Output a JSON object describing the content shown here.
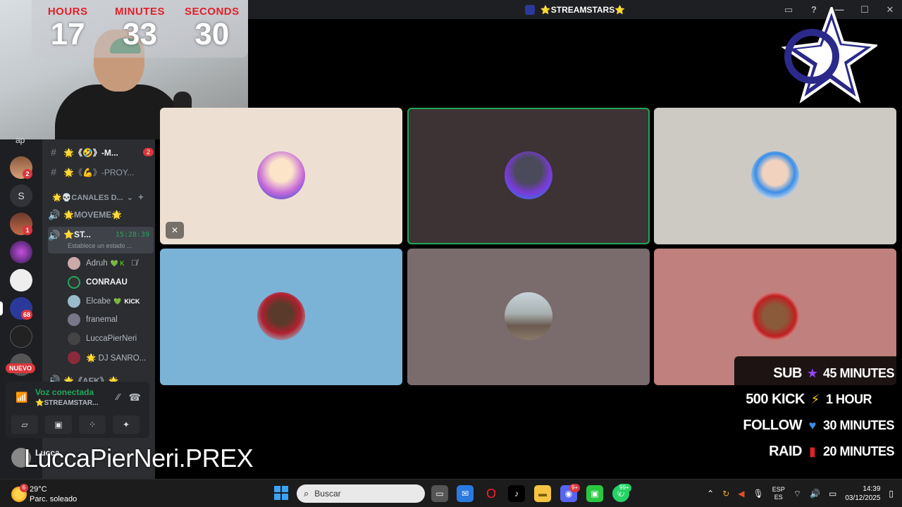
{
  "window": {
    "title": "⭐STREAMSTARS⭐"
  },
  "timer": {
    "hours_label": "HOURS",
    "hours": "17",
    "minutes_label": "MINUTES",
    "minutes": "33",
    "seconds_label": "SECONDS",
    "seconds": "30"
  },
  "rail": {
    "partial_top": "ap",
    "letter_server": "S",
    "badges": [
      "2",
      "1",
      "68"
    ],
    "nuevo": "NUEVO"
  },
  "channels": {
    "items": [
      {
        "label": "🌟《🤣》-M...",
        "badge": "2"
      },
      {
        "label": "🌟《💪》-PROY..."
      }
    ],
    "category": "🌟💀CANALES D...",
    "voice_moveme": "🌟MOVEME🌟",
    "active_voice": {
      "label": "⭐ST...",
      "time": "15:28:39",
      "status": "Establece un estado ..."
    },
    "members": [
      {
        "name": "Adruh",
        "extra": "💚 K"
      },
      {
        "name": "CONRAAU"
      },
      {
        "name": "Elcabe",
        "extra": "💚",
        "kick": "KICK"
      },
      {
        "name": "franemal"
      },
      {
        "name": "LuccaPierNeri"
      },
      {
        "name": "🌟 DJ SANRO..."
      }
    ],
    "afk": "🌟《AFK》🌟"
  },
  "voice_panel": {
    "status": "Voz conectada",
    "channel": "⭐STREAMSTAR..."
  },
  "user": {
    "name": "Lucca"
  },
  "overlay_name": "LuccaPierNeri.PREX",
  "goals": [
    {
      "left": "SUB",
      "icon": "★",
      "right": "45 MINUTES",
      "icon_color": "#9146ff"
    },
    {
      "left": "500 KICK",
      "icon": "⚡",
      "right": "1 HOUR",
      "icon_color": "#f5c518"
    },
    {
      "left": "FOLLOW",
      "icon": "♥",
      "right": "30 MINUTES",
      "icon_color": "#3a8ee6"
    },
    {
      "left": "RAID",
      "icon": "▮",
      "right": "20 MINUTES",
      "icon_color": "#e0202a"
    }
  ],
  "taskbar": {
    "weather_badge": "6",
    "temperature": "29°C",
    "condition": "Parc. soleado",
    "search_placeholder": "Buscar",
    "discord_badge": "9+",
    "whatsapp_badge": "99+",
    "lang_top": "ESP",
    "lang_bottom": "ES",
    "time": "14:39",
    "date": "03/12/2025"
  },
  "colors": {
    "discord_bg": "#2b2d31",
    "speaking": "#23a55a",
    "danger": "#da373c",
    "tile_colors": [
      "#ede0d2",
      "#3d3234",
      "#cdc9c3",
      "#7ab3d6",
      "#7a6c6d",
      "#c0807d"
    ]
  }
}
